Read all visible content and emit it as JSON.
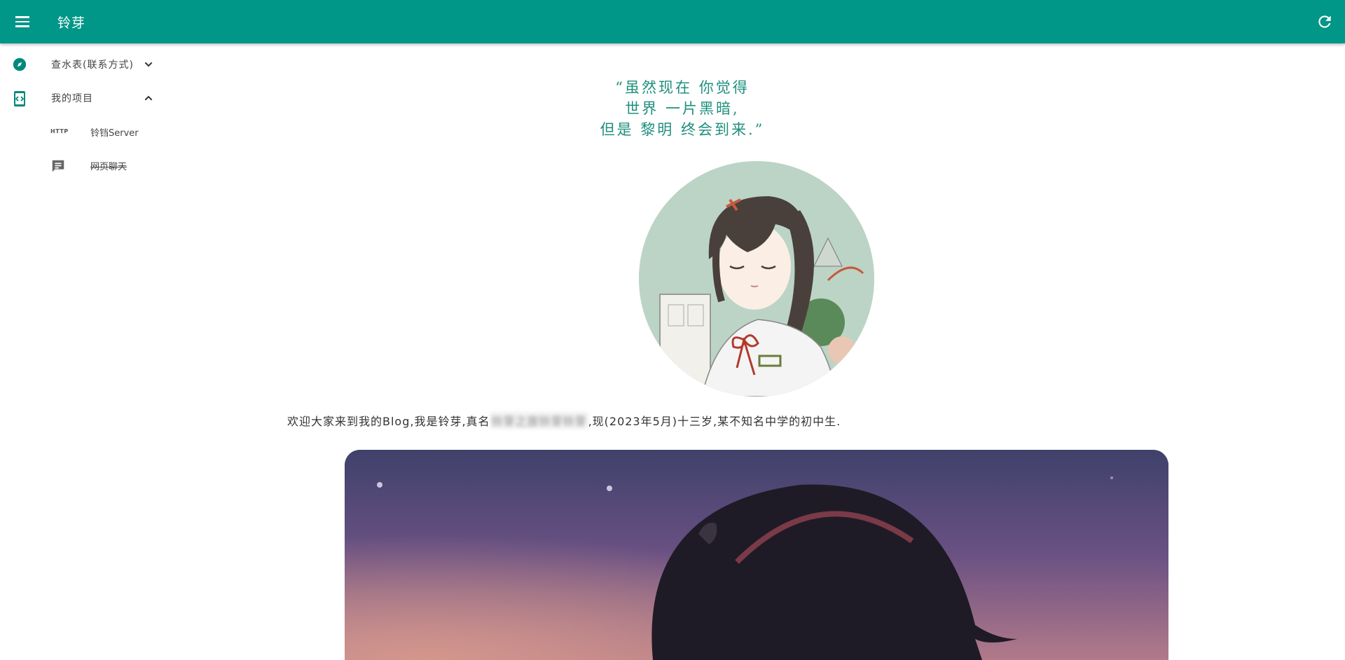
{
  "appbar": {
    "title": "铃芽",
    "menu_icon": "menu-icon",
    "refresh_icon": "refresh-icon",
    "color": "#009688"
  },
  "sidebar": {
    "items": [
      {
        "label": "查水表(联系方式)",
        "icon": "compass-icon",
        "expanded": false
      },
      {
        "label": "我的项目",
        "icon": "code-device-icon",
        "expanded": true
      }
    ],
    "subitems": [
      {
        "badge": "HTTP",
        "label": "铃铛Server"
      },
      {
        "icon": "chat-icon",
        "label": "网页聊天"
      }
    ]
  },
  "main": {
    "quote_lines": [
      "“虽然现在 你觉得",
      "世界 一片黑暗,",
      "但是 黎明 终会到来.”"
    ],
    "intro_before": "欢迎大家来到我的Blog,我是铃芽,真名",
    "intro_redacted": "铃芽之旅铃芽铃芽",
    "intro_after": ",现(2023年5月)十三岁,某不知名中学的初中生.",
    "accent_color": "#1f8f7d"
  }
}
